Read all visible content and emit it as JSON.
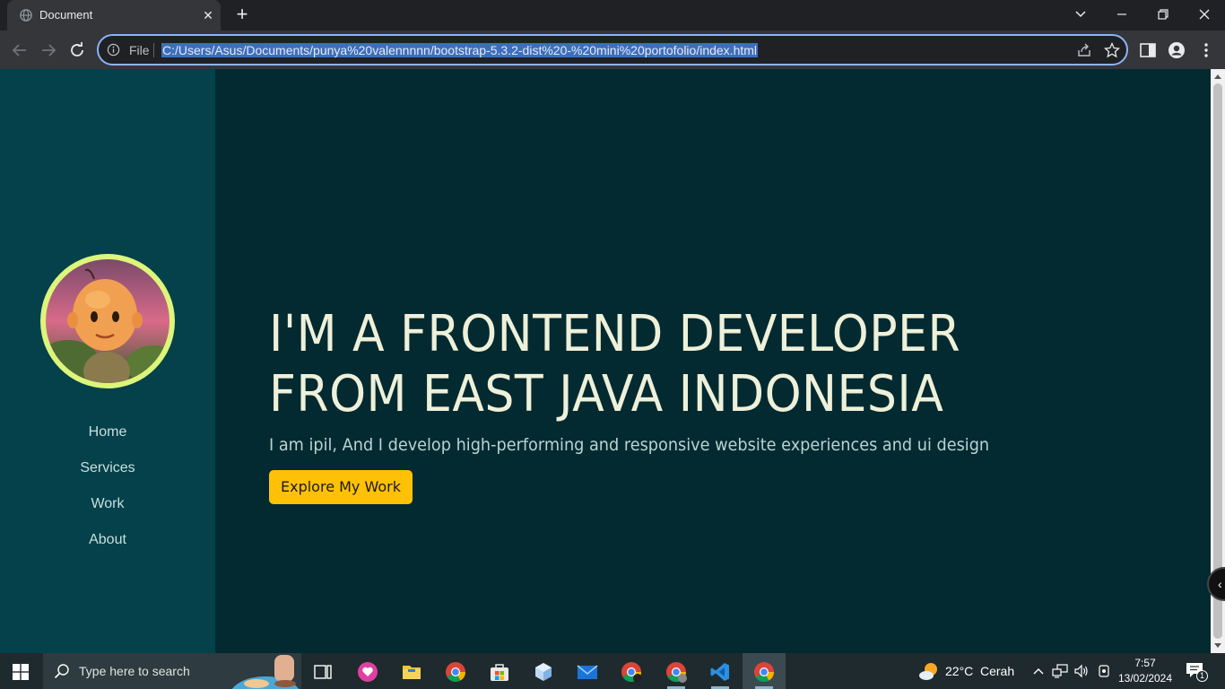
{
  "browser": {
    "tab_title": "Document",
    "close_glyph": "✕",
    "new_tab_glyph": "+",
    "omnibox_scheme": "File",
    "url": "C:/Users/Asus/Documents/punya%20valennnnn/bootstrap-5.3.2-dist%20-%20mini%20portofolio/index.html",
    "accent_color": "#8ab4f8"
  },
  "sidebar": {
    "avatar_alt": "profile picture",
    "nav": [
      {
        "label": "Home"
      },
      {
        "label": "Services"
      },
      {
        "label": "Work"
      },
      {
        "label": "About"
      }
    ],
    "bg_color": "#04414a",
    "ring_color": "#dcf57a"
  },
  "hero": {
    "title_line1": "I'M A FRONTEND DEVELOPER",
    "title_line2": "FROM EAST JAVA INDONESIA",
    "subtitle": "I am ipil, And I develop high-performing and responsive website experiences and ui design",
    "cta_label": "Explore My Work",
    "cta_color": "#ffc107",
    "bg_color": "#032a30"
  },
  "taskbar": {
    "search_placeholder": "Type here to search",
    "weather_temp": "22°C",
    "weather_desc": "Cerah",
    "time": "7:57",
    "date": "13/02/2024",
    "notification_count": "1",
    "apps": [
      "task-view",
      "chat",
      "file-explorer",
      "chrome",
      "microsoft-store",
      "cube-app",
      "mail",
      "chrome-profile-1",
      "chrome-profile-2",
      "vscode",
      "chrome-active"
    ]
  }
}
